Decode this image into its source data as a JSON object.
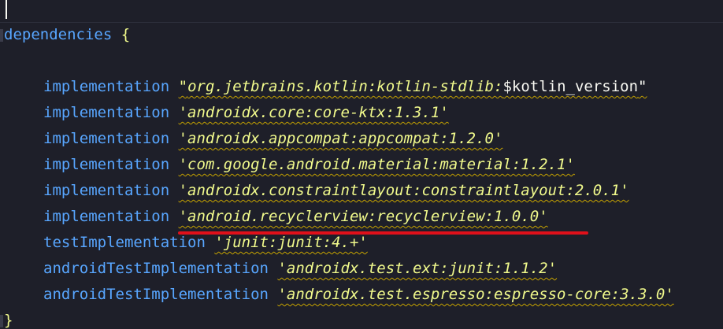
{
  "block": {
    "keyword": "dependencies",
    "open_brace": "{",
    "close_brace": "}"
  },
  "lines": [
    {
      "config": "implementation",
      "q_open": "\"",
      "artifact": "org.jetbrains.kotlin:kotlin-stdlib:",
      "variable": "$kotlin_version",
      "q_close": "\""
    },
    {
      "config": "implementation",
      "value": "'androidx.core:core-ktx:1.3.1'"
    },
    {
      "config": "implementation",
      "value": "'androidx.appcompat:appcompat:1.2.0'"
    },
    {
      "config": "implementation",
      "value": "'com.google.android.material:material:1.2.1'"
    },
    {
      "config": "implementation",
      "value": "'androidx.constraintlayout:constraintlayout:2.0.1'"
    },
    {
      "config": "implementation",
      "value": "'android.recyclerview:recyclerview:1.0.0'"
    },
    {
      "config": "testImplementation",
      "value": "'junit:junit:4.+'"
    },
    {
      "config": "androidTestImplementation",
      "value": "'androidx.test.ext:junit:1.1.2'"
    },
    {
      "config": "androidTestImplementation",
      "value": "'androidx.test.espresso:espresso-core:3.3.0'"
    }
  ],
  "colors": {
    "background": "#1e1f29",
    "keyword": "#58a6ff",
    "string": "#f1fa8c",
    "warning_underline": "#c6a300",
    "highlight_underline": "#e0101a"
  }
}
